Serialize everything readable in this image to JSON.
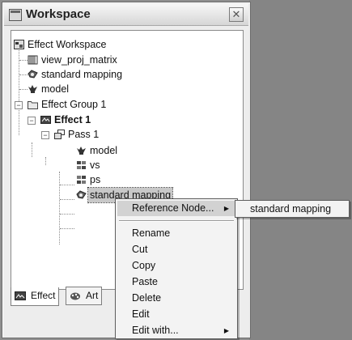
{
  "window": {
    "title": "Workspace",
    "close_glyph": "✕"
  },
  "tree": {
    "root": "Effect Workspace",
    "items": [
      {
        "label": "view_proj_matrix",
        "icon": "matrix-icon"
      },
      {
        "label": "standard mapping",
        "icon": "shader-icon"
      },
      {
        "label": "model",
        "icon": "model-icon"
      },
      {
        "label": "Effect Group 1",
        "icon": "folder-icon"
      },
      {
        "label": "Effect 1",
        "icon": "effect-icon"
      },
      {
        "label": "Pass 1",
        "icon": "pass-icon"
      },
      {
        "label": "model",
        "icon": "model-icon"
      },
      {
        "label": "vs",
        "icon": "vertex-shader-icon"
      },
      {
        "label": "ps",
        "icon": "pixel-shader-icon"
      },
      {
        "label": "standard mapping",
        "icon": "shader-icon",
        "selected": true
      }
    ],
    "toggles": {
      "collapse": "−"
    }
  },
  "tabs": [
    {
      "label": "Effect",
      "active": true
    },
    {
      "label": "Art",
      "active": false
    }
  ],
  "context_menu": {
    "items": [
      {
        "label": "Reference Node...",
        "submenu": true,
        "highlighted": true
      },
      {
        "label": "Rename"
      },
      {
        "label": "Cut"
      },
      {
        "label": "Copy"
      },
      {
        "label": "Paste"
      },
      {
        "label": "Delete"
      },
      {
        "label": "Edit"
      },
      {
        "label": "Edit with...",
        "submenu": true
      }
    ],
    "submenu_arrow": "▶"
  },
  "sub_menu": {
    "items": [
      {
        "label": "standard mapping"
      }
    ]
  }
}
